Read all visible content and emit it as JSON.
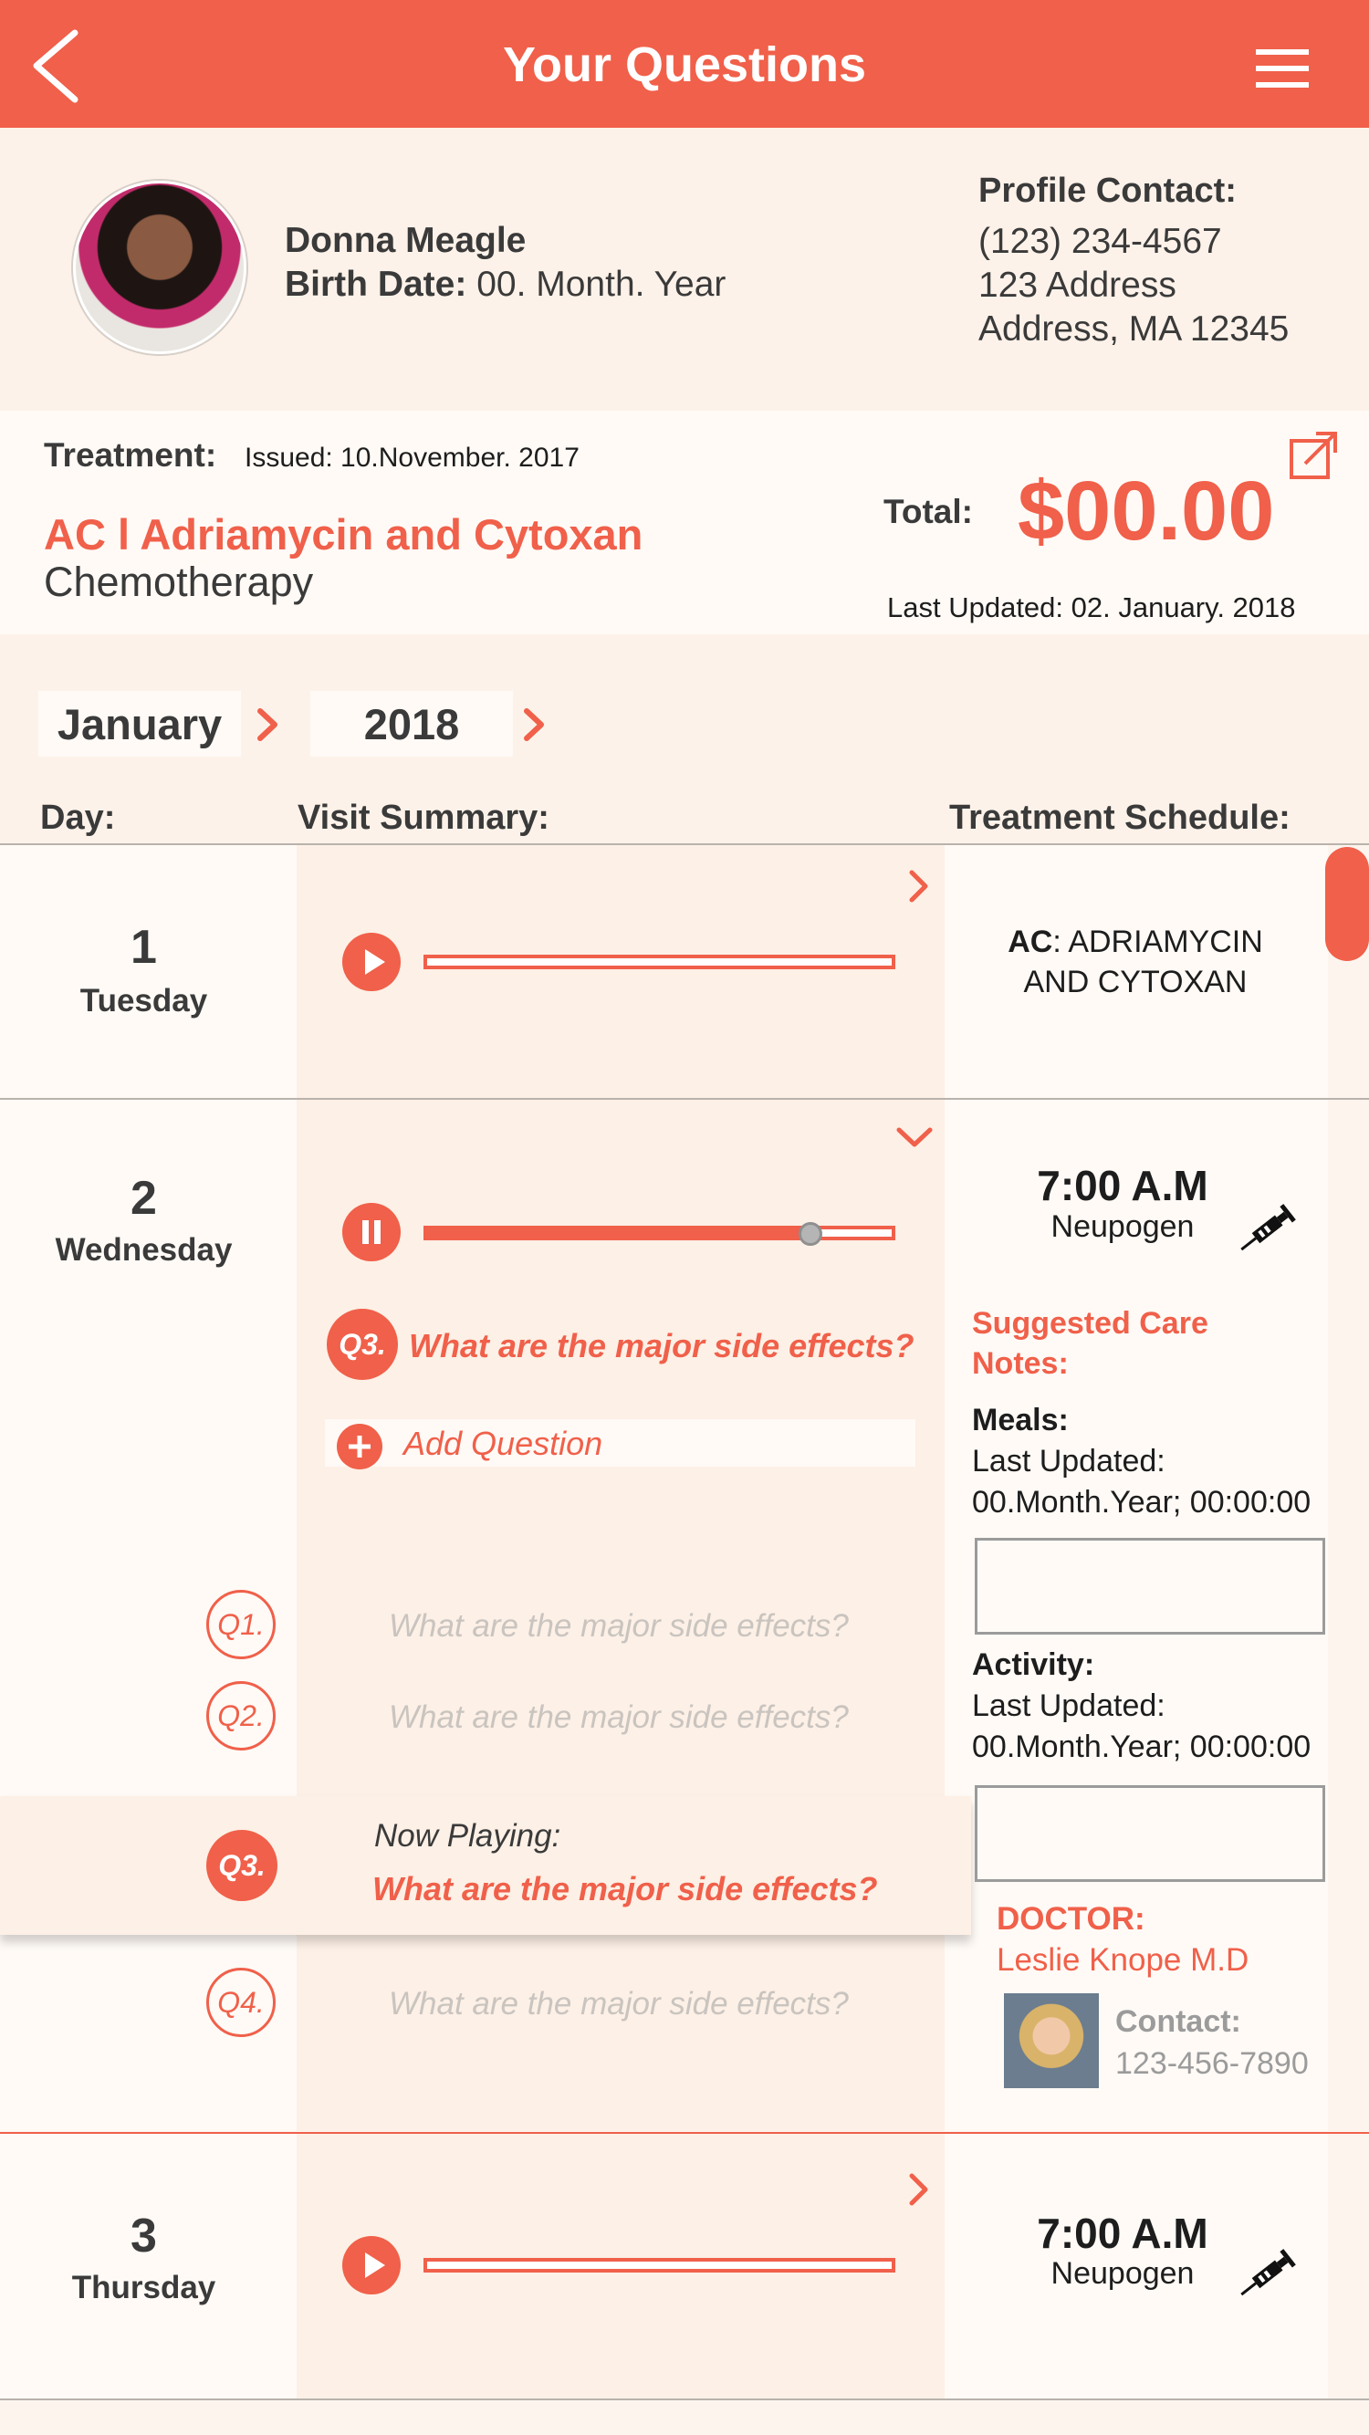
{
  "header": {
    "title": "Your Questions",
    "back_icon": "chevron-left-icon",
    "menu_icon": "hamburger-menu-icon"
  },
  "profile": {
    "name": "Donna Meagle",
    "birth_label": "Birth Date:",
    "birth_value": "00. Month. Year",
    "contact_label": "Profile Contact:",
    "phone": "(123) 234-4567",
    "address1": "123 Address",
    "address2": "Address, MA 12345"
  },
  "treatment": {
    "label": "Treatment:",
    "issued": "Issued: 10.November. 2017",
    "name": "AC l Adriamycin and Cytoxan",
    "type": "Chemotherapy",
    "total_label": "Total:",
    "total_value": "$00.00",
    "last_updated": "Last Updated: 02. January. 2018"
  },
  "selector": {
    "month": "January",
    "year": "2018"
  },
  "columns": {
    "day": "Day:",
    "visit": "Visit Summary:",
    "schedule": "Treatment Schedule:"
  },
  "days": [
    {
      "number": "1",
      "name": "Tuesday",
      "progress": 0,
      "schedule_bold": "AC",
      "schedule_line1_rest": ": ADRIAMYCIN",
      "schedule_line2": "AND CYTOXAN"
    },
    {
      "number": "2",
      "name": "Wednesday",
      "progress": 0.82,
      "active_question": {
        "badge": "Q3.",
        "text": "What are the major side effects?"
      },
      "add_question": "Add Question",
      "questions": [
        {
          "badge": "Q1.",
          "text": "What are the major side effects?"
        },
        {
          "badge": "Q2.",
          "text": "What are the major side effects?"
        },
        {
          "badge": "Q4.",
          "text": "What are the major side effects?"
        }
      ],
      "now_playing": {
        "badge": "Q3.",
        "label": "Now Playing:",
        "text": "What are the major side effects?"
      },
      "schedule": {
        "time": "7:00 A.M",
        "drug": "Neupogen",
        "notes_title_1": "Suggested Care",
        "notes_title_2": "Notes:",
        "meals_label": "Meals:",
        "meals_updated_label": "Last Updated:",
        "meals_updated_value": "00.Month.Year; 00:00:00",
        "activity_label": "Activity:",
        "activity_updated_label": "Last Updated:",
        "activity_updated_value": "00.Month.Year; 00:00:00",
        "doctor_label": "DOCTOR:",
        "doctor_name": "Leslie Knope M.D",
        "contact_label": "Contact:",
        "contact_phone": "123-456-7890"
      }
    },
    {
      "number": "3",
      "name": "Thursday",
      "progress": 0,
      "schedule": {
        "time": "7:00 A.M",
        "drug": "Neupogen"
      }
    }
  ],
  "colors": {
    "accent": "#f0604a",
    "background": "#fdf4ee",
    "text": "#3a3a3a"
  }
}
